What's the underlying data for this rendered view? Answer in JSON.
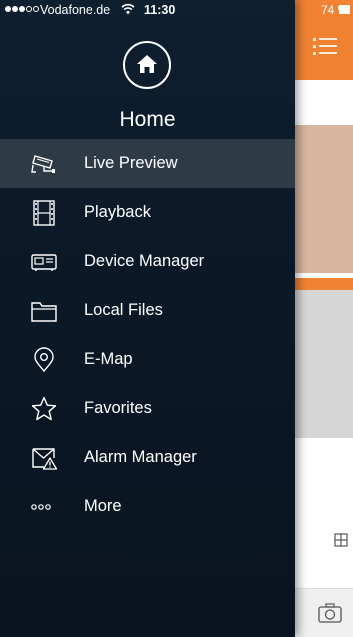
{
  "status_bar": {
    "carrier": "Vodafone.de",
    "time": "11:30",
    "battery": "74 %"
  },
  "header": {
    "title": "Home"
  },
  "menu": {
    "items": [
      {
        "label": "Live Preview",
        "icon": "cctv-camera-icon",
        "active": true
      },
      {
        "label": "Playback",
        "icon": "film-strip-icon",
        "active": false
      },
      {
        "label": "Device Manager",
        "icon": "dvr-device-icon",
        "active": false
      },
      {
        "label": "Local Files",
        "icon": "folder-icon",
        "active": false
      },
      {
        "label": "E-Map",
        "icon": "map-pin-icon",
        "active": false
      },
      {
        "label": "Favorites",
        "icon": "star-icon",
        "active": false
      },
      {
        "label": "Alarm Manager",
        "icon": "alarm-envelope-icon",
        "active": false
      },
      {
        "label": "More",
        "icon": "more-dots-icon",
        "active": false
      }
    ]
  },
  "colors": {
    "drawer_bg": "#0b1826",
    "active_row": "#2e3b47",
    "accent_orange": "#f08232"
  }
}
